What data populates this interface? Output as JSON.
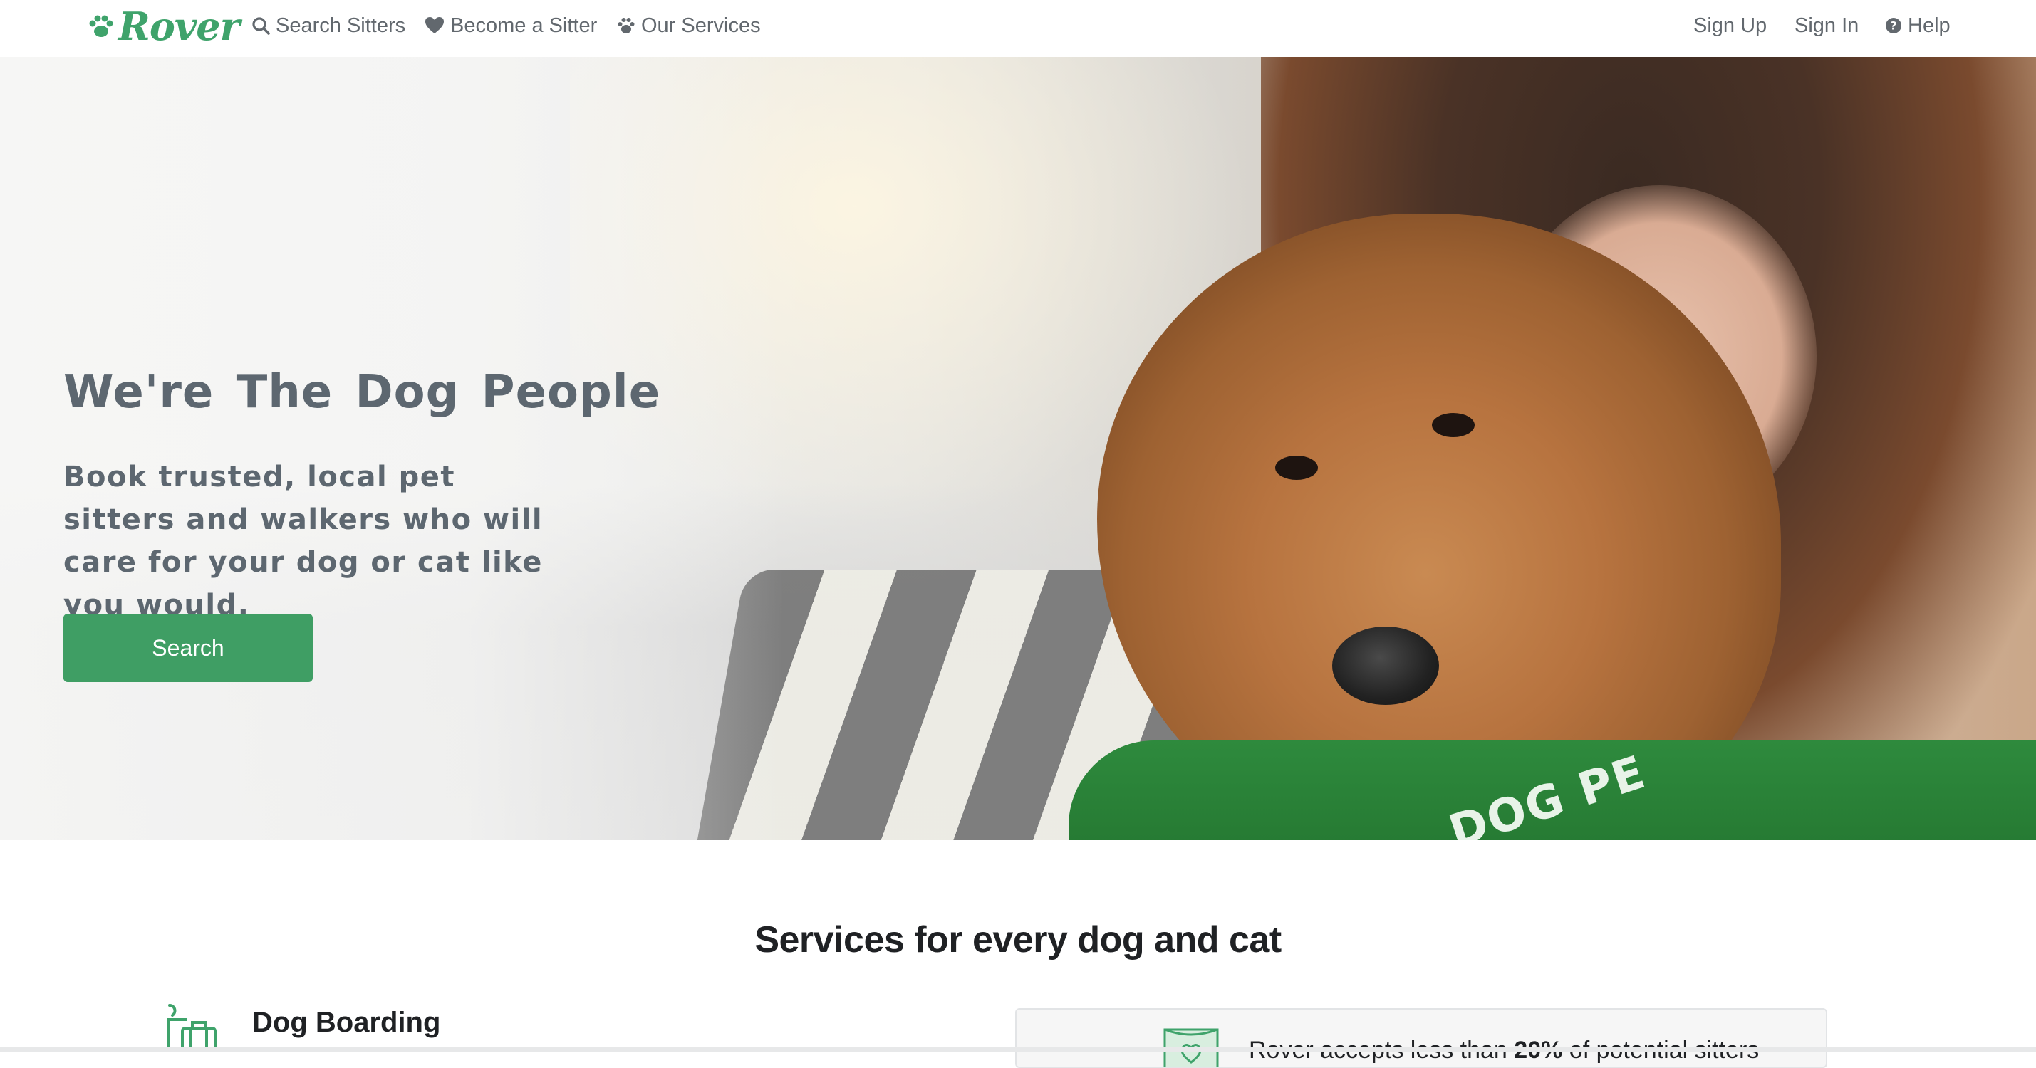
{
  "nav": {
    "logo_text": "Rover",
    "logo_icon": "paw-icon",
    "left_items": [
      {
        "label": "Search Sitters",
        "icon": "search-icon"
      },
      {
        "label": "Become a Sitter",
        "icon": "heart-icon"
      },
      {
        "label": "Our Services",
        "icon": "paw-icon"
      }
    ],
    "right_items": [
      {
        "label": "Sign Up"
      },
      {
        "label": "Sign In"
      },
      {
        "label": "Help",
        "icon": "question-circle-icon"
      }
    ]
  },
  "hero": {
    "title": "We're The Dog People",
    "subtitle": "Book trusted, local pet sitters and walkers who will care for your dog or cat like you would.",
    "search_button": "Search",
    "shirt_text": "DOG PE"
  },
  "services": {
    "heading": "Services for every dog and cat",
    "items": [
      {
        "title": "Dog Boarding",
        "icon": "dog-boarding-icon"
      }
    ],
    "trust_card": {
      "icon": "badge-icon",
      "text_before": "Rover accepts less than ",
      "text_bold": "20%",
      "text_after": " of potential sitters"
    }
  },
  "colors": {
    "brand_green": "#3fa36b",
    "button_green": "#3f9e64",
    "nav_text": "#62686e",
    "hero_text": "#5d6770",
    "heading_text": "#1f2124"
  }
}
